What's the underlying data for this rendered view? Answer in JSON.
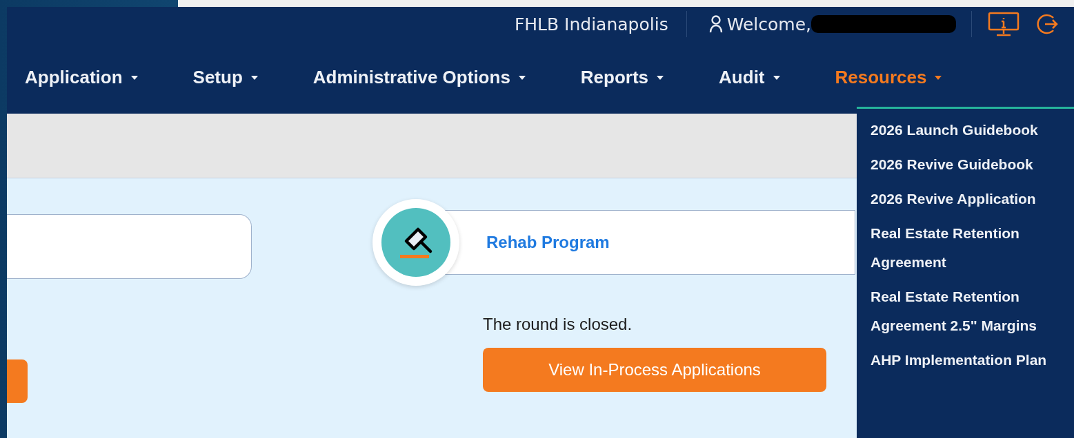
{
  "header": {
    "org": "FHLB Indianapolis",
    "welcome": "Welcome,"
  },
  "nav": [
    {
      "label": "Application",
      "selected": false
    },
    {
      "label": "Setup",
      "selected": false
    },
    {
      "label": "Administrative Options",
      "selected": false
    },
    {
      "label": "Reports",
      "selected": false
    },
    {
      "label": "Audit",
      "selected": false
    },
    {
      "label": "Resources",
      "selected": true
    }
  ],
  "resources_menu": [
    "2026 Launch Guidebook",
    "2026 Revive Guidebook",
    "2026 Revive Application",
    "Real Estate Retention Agreement",
    "Real Estate Retention Agreement 2.5\" Margins",
    "AHP Implementation Plan"
  ],
  "program_card": {
    "title": "Rehab Program",
    "status": "The round is closed.",
    "button": "View In-Process Applications"
  }
}
